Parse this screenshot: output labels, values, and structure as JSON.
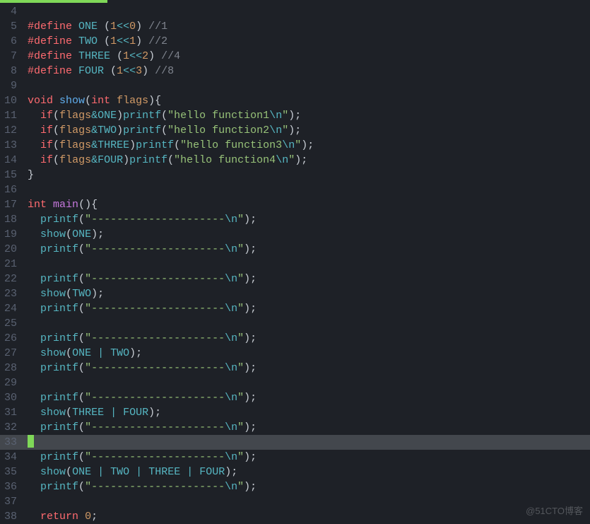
{
  "watermark": "@51CTO博客",
  "lines": [
    {
      "n": 4,
      "current": false,
      "tokens": []
    },
    {
      "n": 5,
      "current": false,
      "tokens": [
        {
          "c": "c-pre",
          "t": "#define"
        },
        {
          "c": "c-punc",
          "t": " "
        },
        {
          "c": "c-macro",
          "t": "ONE"
        },
        {
          "c": "c-punc",
          "t": " ("
        },
        {
          "c": "c-num",
          "t": "1"
        },
        {
          "c": "c-op",
          "t": "<<"
        },
        {
          "c": "c-num",
          "t": "0"
        },
        {
          "c": "c-punc",
          "t": ") "
        },
        {
          "c": "c-cmt",
          "t": "//1"
        }
      ]
    },
    {
      "n": 6,
      "current": false,
      "tokens": [
        {
          "c": "c-pre",
          "t": "#define"
        },
        {
          "c": "c-punc",
          "t": " "
        },
        {
          "c": "c-macro",
          "t": "TWO"
        },
        {
          "c": "c-punc",
          "t": " ("
        },
        {
          "c": "c-num",
          "t": "1"
        },
        {
          "c": "c-op",
          "t": "<<"
        },
        {
          "c": "c-num",
          "t": "1"
        },
        {
          "c": "c-punc",
          "t": ") "
        },
        {
          "c": "c-cmt",
          "t": "//2"
        }
      ]
    },
    {
      "n": 7,
      "current": false,
      "tokens": [
        {
          "c": "c-pre",
          "t": "#define"
        },
        {
          "c": "c-punc",
          "t": " "
        },
        {
          "c": "c-macro",
          "t": "THREE"
        },
        {
          "c": "c-punc",
          "t": " ("
        },
        {
          "c": "c-num",
          "t": "1"
        },
        {
          "c": "c-op",
          "t": "<<"
        },
        {
          "c": "c-num",
          "t": "2"
        },
        {
          "c": "c-punc",
          "t": ") "
        },
        {
          "c": "c-cmt",
          "t": "//4"
        }
      ]
    },
    {
      "n": 8,
      "current": false,
      "tokens": [
        {
          "c": "c-pre",
          "t": "#define"
        },
        {
          "c": "c-punc",
          "t": " "
        },
        {
          "c": "c-macro",
          "t": "FOUR"
        },
        {
          "c": "c-punc",
          "t": " ("
        },
        {
          "c": "c-num",
          "t": "1"
        },
        {
          "c": "c-op",
          "t": "<<"
        },
        {
          "c": "c-num",
          "t": "3"
        },
        {
          "c": "c-punc",
          "t": ") "
        },
        {
          "c": "c-cmt",
          "t": "//8"
        }
      ]
    },
    {
      "n": 9,
      "current": false,
      "tokens": []
    },
    {
      "n": 10,
      "current": false,
      "tokens": [
        {
          "c": "c-kw",
          "t": "void"
        },
        {
          "c": "c-punc",
          "t": " "
        },
        {
          "c": "c-func",
          "t": "show"
        },
        {
          "c": "c-punc",
          "t": "("
        },
        {
          "c": "c-kw",
          "t": "int"
        },
        {
          "c": "c-punc",
          "t": " "
        },
        {
          "c": "c-param",
          "t": "flags"
        },
        {
          "c": "c-punc",
          "t": "){"
        }
      ]
    },
    {
      "n": 11,
      "current": false,
      "tokens": [
        {
          "c": "c-punc",
          "t": "  "
        },
        {
          "c": "c-kw",
          "t": "if"
        },
        {
          "c": "c-punc",
          "t": "("
        },
        {
          "c": "c-param",
          "t": "flags"
        },
        {
          "c": "c-op",
          "t": "&"
        },
        {
          "c": "c-macro",
          "t": "ONE"
        },
        {
          "c": "c-punc",
          "t": ")"
        },
        {
          "c": "c-call",
          "t": "printf"
        },
        {
          "c": "c-punc",
          "t": "("
        },
        {
          "c": "c-str",
          "t": "\"hello function1"
        },
        {
          "c": "c-esc",
          "t": "\\n"
        },
        {
          "c": "c-str",
          "t": "\""
        },
        {
          "c": "c-punc",
          "t": ");"
        }
      ]
    },
    {
      "n": 12,
      "current": false,
      "tokens": [
        {
          "c": "c-punc",
          "t": "  "
        },
        {
          "c": "c-kw",
          "t": "if"
        },
        {
          "c": "c-punc",
          "t": "("
        },
        {
          "c": "c-param",
          "t": "flags"
        },
        {
          "c": "c-op",
          "t": "&"
        },
        {
          "c": "c-macro",
          "t": "TWO"
        },
        {
          "c": "c-punc",
          "t": ")"
        },
        {
          "c": "c-call",
          "t": "printf"
        },
        {
          "c": "c-punc",
          "t": "("
        },
        {
          "c": "c-str",
          "t": "\"hello function2"
        },
        {
          "c": "c-esc",
          "t": "\\n"
        },
        {
          "c": "c-str",
          "t": "\""
        },
        {
          "c": "c-punc",
          "t": ");"
        }
      ]
    },
    {
      "n": 13,
      "current": false,
      "tokens": [
        {
          "c": "c-punc",
          "t": "  "
        },
        {
          "c": "c-kw",
          "t": "if"
        },
        {
          "c": "c-punc",
          "t": "("
        },
        {
          "c": "c-param",
          "t": "flags"
        },
        {
          "c": "c-op",
          "t": "&"
        },
        {
          "c": "c-macro",
          "t": "THREE"
        },
        {
          "c": "c-punc",
          "t": ")"
        },
        {
          "c": "c-call",
          "t": "printf"
        },
        {
          "c": "c-punc",
          "t": "("
        },
        {
          "c": "c-str",
          "t": "\"hello function3"
        },
        {
          "c": "c-esc",
          "t": "\\n"
        },
        {
          "c": "c-str",
          "t": "\""
        },
        {
          "c": "c-punc",
          "t": ");"
        }
      ]
    },
    {
      "n": 14,
      "current": false,
      "tokens": [
        {
          "c": "c-punc",
          "t": "  "
        },
        {
          "c": "c-kw",
          "t": "if"
        },
        {
          "c": "c-punc",
          "t": "("
        },
        {
          "c": "c-param",
          "t": "flags"
        },
        {
          "c": "c-op",
          "t": "&"
        },
        {
          "c": "c-macro",
          "t": "FOUR"
        },
        {
          "c": "c-punc",
          "t": ")"
        },
        {
          "c": "c-call",
          "t": "printf"
        },
        {
          "c": "c-punc",
          "t": "("
        },
        {
          "c": "c-str",
          "t": "\"hello function4"
        },
        {
          "c": "c-esc",
          "t": "\\n"
        },
        {
          "c": "c-str",
          "t": "\""
        },
        {
          "c": "c-punc",
          "t": ");"
        }
      ]
    },
    {
      "n": 15,
      "current": false,
      "tokens": [
        {
          "c": "c-punc",
          "t": "}"
        }
      ]
    },
    {
      "n": 16,
      "current": false,
      "tokens": []
    },
    {
      "n": 17,
      "current": false,
      "tokens": [
        {
          "c": "c-kw",
          "t": "int"
        },
        {
          "c": "c-punc",
          "t": " "
        },
        {
          "c": "c-id",
          "t": "main"
        },
        {
          "c": "c-punc",
          "t": "(){"
        }
      ]
    },
    {
      "n": 18,
      "current": false,
      "tokens": [
        {
          "c": "c-punc",
          "t": "  "
        },
        {
          "c": "c-call",
          "t": "printf"
        },
        {
          "c": "c-punc",
          "t": "("
        },
        {
          "c": "c-str",
          "t": "\"---------------------"
        },
        {
          "c": "c-esc",
          "t": "\\n"
        },
        {
          "c": "c-str",
          "t": "\""
        },
        {
          "c": "c-punc",
          "t": ");"
        }
      ]
    },
    {
      "n": 19,
      "current": false,
      "tokens": [
        {
          "c": "c-punc",
          "t": "  "
        },
        {
          "c": "c-call",
          "t": "show"
        },
        {
          "c": "c-punc",
          "t": "("
        },
        {
          "c": "c-macro",
          "t": "ONE"
        },
        {
          "c": "c-punc",
          "t": ");"
        }
      ]
    },
    {
      "n": 20,
      "current": false,
      "tokens": [
        {
          "c": "c-punc",
          "t": "  "
        },
        {
          "c": "c-call",
          "t": "printf"
        },
        {
          "c": "c-punc",
          "t": "("
        },
        {
          "c": "c-str",
          "t": "\"---------------------"
        },
        {
          "c": "c-esc",
          "t": "\\n"
        },
        {
          "c": "c-str",
          "t": "\""
        },
        {
          "c": "c-punc",
          "t": ");"
        }
      ]
    },
    {
      "n": 21,
      "current": false,
      "tokens": []
    },
    {
      "n": 22,
      "current": false,
      "tokens": [
        {
          "c": "c-punc",
          "t": "  "
        },
        {
          "c": "c-call",
          "t": "printf"
        },
        {
          "c": "c-punc",
          "t": "("
        },
        {
          "c": "c-str",
          "t": "\"---------------------"
        },
        {
          "c": "c-esc",
          "t": "\\n"
        },
        {
          "c": "c-str",
          "t": "\""
        },
        {
          "c": "c-punc",
          "t": ");"
        }
      ]
    },
    {
      "n": 23,
      "current": false,
      "tokens": [
        {
          "c": "c-punc",
          "t": "  "
        },
        {
          "c": "c-call",
          "t": "show"
        },
        {
          "c": "c-punc",
          "t": "("
        },
        {
          "c": "c-macro",
          "t": "TWO"
        },
        {
          "c": "c-punc",
          "t": ");"
        }
      ]
    },
    {
      "n": 24,
      "current": false,
      "tokens": [
        {
          "c": "c-punc",
          "t": "  "
        },
        {
          "c": "c-call",
          "t": "printf"
        },
        {
          "c": "c-punc",
          "t": "("
        },
        {
          "c": "c-str",
          "t": "\"---------------------"
        },
        {
          "c": "c-esc",
          "t": "\\n"
        },
        {
          "c": "c-str",
          "t": "\""
        },
        {
          "c": "c-punc",
          "t": ");"
        }
      ]
    },
    {
      "n": 25,
      "current": false,
      "tokens": []
    },
    {
      "n": 26,
      "current": false,
      "tokens": [
        {
          "c": "c-punc",
          "t": "  "
        },
        {
          "c": "c-call",
          "t": "printf"
        },
        {
          "c": "c-punc",
          "t": "("
        },
        {
          "c": "c-str",
          "t": "\"---------------------"
        },
        {
          "c": "c-esc",
          "t": "\\n"
        },
        {
          "c": "c-str",
          "t": "\""
        },
        {
          "c": "c-punc",
          "t": ");"
        }
      ]
    },
    {
      "n": 27,
      "current": false,
      "tokens": [
        {
          "c": "c-punc",
          "t": "  "
        },
        {
          "c": "c-call",
          "t": "show"
        },
        {
          "c": "c-punc",
          "t": "("
        },
        {
          "c": "c-macro",
          "t": "ONE"
        },
        {
          "c": "c-punc",
          "t": " "
        },
        {
          "c": "c-op",
          "t": "|"
        },
        {
          "c": "c-punc",
          "t": " "
        },
        {
          "c": "c-macro",
          "t": "TWO"
        },
        {
          "c": "c-punc",
          "t": ");"
        }
      ]
    },
    {
      "n": 28,
      "current": false,
      "tokens": [
        {
          "c": "c-punc",
          "t": "  "
        },
        {
          "c": "c-call",
          "t": "printf"
        },
        {
          "c": "c-punc",
          "t": "("
        },
        {
          "c": "c-str",
          "t": "\"---------------------"
        },
        {
          "c": "c-esc",
          "t": "\\n"
        },
        {
          "c": "c-str",
          "t": "\""
        },
        {
          "c": "c-punc",
          "t": ");"
        }
      ]
    },
    {
      "n": 29,
      "current": false,
      "tokens": []
    },
    {
      "n": 30,
      "current": false,
      "tokens": [
        {
          "c": "c-punc",
          "t": "  "
        },
        {
          "c": "c-call",
          "t": "printf"
        },
        {
          "c": "c-punc",
          "t": "("
        },
        {
          "c": "c-str",
          "t": "\"---------------------"
        },
        {
          "c": "c-esc",
          "t": "\\n"
        },
        {
          "c": "c-str",
          "t": "\""
        },
        {
          "c": "c-punc",
          "t": ");"
        }
      ]
    },
    {
      "n": 31,
      "current": false,
      "tokens": [
        {
          "c": "c-punc",
          "t": "  "
        },
        {
          "c": "c-call",
          "t": "show"
        },
        {
          "c": "c-punc",
          "t": "("
        },
        {
          "c": "c-macro",
          "t": "THREE"
        },
        {
          "c": "c-punc",
          "t": " "
        },
        {
          "c": "c-op",
          "t": "|"
        },
        {
          "c": "c-punc",
          "t": " "
        },
        {
          "c": "c-macro",
          "t": "FOUR"
        },
        {
          "c": "c-punc",
          "t": ");"
        }
      ]
    },
    {
      "n": 32,
      "current": false,
      "tokens": [
        {
          "c": "c-punc",
          "t": "  "
        },
        {
          "c": "c-call",
          "t": "printf"
        },
        {
          "c": "c-punc",
          "t": "("
        },
        {
          "c": "c-str",
          "t": "\"---------------------"
        },
        {
          "c": "c-esc",
          "t": "\\n"
        },
        {
          "c": "c-str",
          "t": "\""
        },
        {
          "c": "c-punc",
          "t": ");"
        }
      ]
    },
    {
      "n": 33,
      "current": true,
      "cursor": true,
      "tokens": []
    },
    {
      "n": 34,
      "current": false,
      "tokens": [
        {
          "c": "c-punc",
          "t": "  "
        },
        {
          "c": "c-call",
          "t": "printf"
        },
        {
          "c": "c-punc",
          "t": "("
        },
        {
          "c": "c-str",
          "t": "\"---------------------"
        },
        {
          "c": "c-esc",
          "t": "\\n"
        },
        {
          "c": "c-str",
          "t": "\""
        },
        {
          "c": "c-punc",
          "t": ");"
        }
      ]
    },
    {
      "n": 35,
      "current": false,
      "tokens": [
        {
          "c": "c-punc",
          "t": "  "
        },
        {
          "c": "c-call",
          "t": "show"
        },
        {
          "c": "c-punc",
          "t": "("
        },
        {
          "c": "c-macro",
          "t": "ONE"
        },
        {
          "c": "c-punc",
          "t": " "
        },
        {
          "c": "c-op",
          "t": "|"
        },
        {
          "c": "c-punc",
          "t": " "
        },
        {
          "c": "c-macro",
          "t": "TWO"
        },
        {
          "c": "c-punc",
          "t": " "
        },
        {
          "c": "c-op",
          "t": "|"
        },
        {
          "c": "c-punc",
          "t": " "
        },
        {
          "c": "c-macro",
          "t": "THREE"
        },
        {
          "c": "c-punc",
          "t": " "
        },
        {
          "c": "c-op",
          "t": "|"
        },
        {
          "c": "c-punc",
          "t": " "
        },
        {
          "c": "c-macro",
          "t": "FOUR"
        },
        {
          "c": "c-punc",
          "t": ");"
        }
      ]
    },
    {
      "n": 36,
      "current": false,
      "tokens": [
        {
          "c": "c-punc",
          "t": "  "
        },
        {
          "c": "c-call",
          "t": "printf"
        },
        {
          "c": "c-punc",
          "t": "("
        },
        {
          "c": "c-str",
          "t": "\"---------------------"
        },
        {
          "c": "c-esc",
          "t": "\\n"
        },
        {
          "c": "c-str",
          "t": "\""
        },
        {
          "c": "c-punc",
          "t": ");"
        }
      ]
    },
    {
      "n": 37,
      "current": false,
      "tokens": []
    },
    {
      "n": 38,
      "current": false,
      "tokens": [
        {
          "c": "c-punc",
          "t": "  "
        },
        {
          "c": "c-kw",
          "t": "return"
        },
        {
          "c": "c-punc",
          "t": " "
        },
        {
          "c": "c-num",
          "t": "0"
        },
        {
          "c": "c-punc",
          "t": ";"
        }
      ]
    }
  ]
}
